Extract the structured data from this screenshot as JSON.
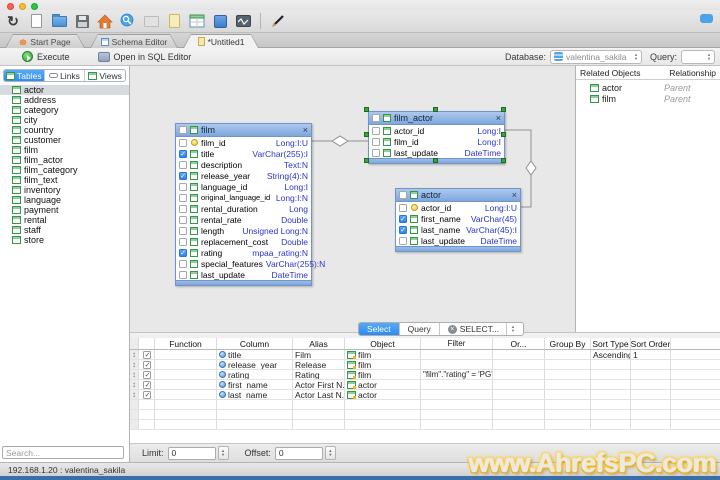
{
  "window": {
    "traffic_lights": [
      "close",
      "minimize",
      "zoom"
    ]
  },
  "toolbar": {
    "icons": [
      "refresh-icon",
      "new-document-icon",
      "open-folder-icon",
      "save-icon",
      "home-icon",
      "search-icon",
      "mail-icon",
      "report-icon",
      "schema-icon",
      "book-icon",
      "sql-console-icon",
      "pen-icon"
    ],
    "chat_icon": "chat-icon"
  },
  "tabs": [
    {
      "label": "Start Page",
      "icon": "home-icon"
    },
    {
      "label": "Schema Editor",
      "icon": "schema-icon"
    },
    {
      "label": "*Untitled1",
      "icon": "document-icon",
      "active": true
    }
  ],
  "querybar": {
    "execute": "Execute",
    "open_sql": "Open in SQL Editor",
    "database_label": "Database:",
    "database_value": "valentina_sakila",
    "query_label": "Query:",
    "query_value": ""
  },
  "sidebar": {
    "tabs": [
      "Tables",
      "Links",
      "Views"
    ],
    "active_tab": "Tables",
    "tables": [
      "actor",
      "address",
      "category",
      "city",
      "country",
      "customer",
      "film",
      "film_actor",
      "film_category",
      "film_text",
      "inventory",
      "language",
      "payment",
      "rental",
      "staff",
      "store"
    ],
    "selected_table": "actor",
    "search_placeholder": "Search..."
  },
  "diagram": {
    "tables": [
      {
        "name": "film",
        "fields": [
          {
            "name": "film_id",
            "type": "Long:I:U",
            "key": true
          },
          {
            "name": "title",
            "type": "VarChar(255):I",
            "checked": true
          },
          {
            "name": "description",
            "type": "Text:N"
          },
          {
            "name": "release_year",
            "type": "String(4):N",
            "checked": true
          },
          {
            "name": "language_id",
            "type": "Long:I"
          },
          {
            "name": "original_language_id",
            "type": "Long:I:N"
          },
          {
            "name": "rental_duration",
            "type": "Long"
          },
          {
            "name": "rental_rate",
            "type": "Double"
          },
          {
            "name": "length",
            "type": "Unsigned Long:N"
          },
          {
            "name": "replacement_cost",
            "type": "Double"
          },
          {
            "name": "rating",
            "type": "mpaa_rating:N",
            "checked": true
          },
          {
            "name": "special_features",
            "type": "VarChar(255):N"
          },
          {
            "name": "last_update",
            "type": "DateTime"
          }
        ]
      },
      {
        "name": "film_actor",
        "selected": true,
        "fields": [
          {
            "name": "actor_id",
            "type": "Long:I"
          },
          {
            "name": "film_id",
            "type": "Long:I"
          },
          {
            "name": "last_update",
            "type": "DateTime"
          }
        ]
      },
      {
        "name": "actor",
        "fields": [
          {
            "name": "actor_id",
            "type": "Long:I:U",
            "key": true
          },
          {
            "name": "first_name",
            "type": "VarChar(45)",
            "checked": true
          },
          {
            "name": "last_name",
            "type": "VarChar(45):I",
            "checked": true
          },
          {
            "name": "last_update",
            "type": "DateTime"
          }
        ]
      }
    ]
  },
  "related": {
    "title": "Related Objects",
    "relationship_col": "Relationship",
    "rows": [
      {
        "name": "actor",
        "relationship": "Parent"
      },
      {
        "name": "film",
        "relationship": "Parent"
      }
    ]
  },
  "bottom_tabs": {
    "select": "Select",
    "query": "Query",
    "statement": "SELECT..."
  },
  "grid": {
    "headers": {
      "function": "Function",
      "column": "Column",
      "alias": "Alias",
      "object": "Object",
      "filter": "Filter",
      "or": "Or...",
      "group_by": "Group By",
      "sort_type": "Sort Type",
      "sort_order": "Sort Order"
    },
    "rows": [
      {
        "column": "title",
        "alias": "Film",
        "object": "film",
        "filter": "",
        "or": "",
        "group_by": "",
        "sort_type": "Ascending",
        "sort_order": "1"
      },
      {
        "column": "release_year",
        "alias": "Release",
        "object": "film",
        "filter": "",
        "or": "",
        "group_by": "",
        "sort_type": "",
        "sort_order": ""
      },
      {
        "column": "rating",
        "alias": "Rating",
        "object": "film",
        "filter": "\"film\".\"rating\" = 'PG'",
        "or": "",
        "group_by": "",
        "sort_type": "",
        "sort_order": ""
      },
      {
        "column": "first_name",
        "alias": "Actor First N...",
        "object": "actor",
        "filter": "",
        "or": "",
        "group_by": "",
        "sort_type": "",
        "sort_order": ""
      },
      {
        "column": "last_name",
        "alias": "Actor Last N...",
        "object": "actor",
        "filter": "",
        "or": "",
        "group_by": "",
        "sort_type": "",
        "sort_order": ""
      }
    ]
  },
  "footer": {
    "limit_label": "Limit:",
    "limit_value": "0",
    "offset_label": "Offset:",
    "offset_value": "0"
  },
  "statusbar": {
    "text": "192.168.1.20 : valentina_sakila"
  },
  "watermark": "www.AhrefsPC.com",
  "colors": {
    "accent_blue": "#3b99fc",
    "table_header_blue": "#8db2e2",
    "type_text_blue": "#2a35cf",
    "selection_green": "#3da43d",
    "watermark_glow": "#ffc414",
    "bottom_strip_blue": "#3a6ea8"
  }
}
